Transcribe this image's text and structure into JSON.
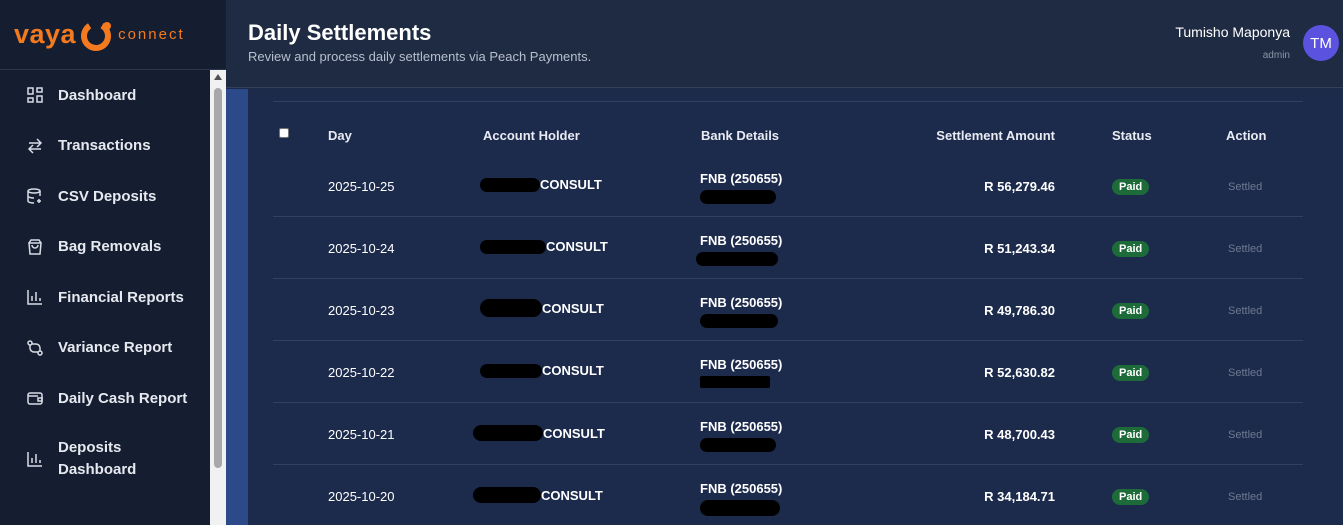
{
  "brand": {
    "word": "vaya",
    "suffix": "connect",
    "color": "#f47a20"
  },
  "sidebar": {
    "items": [
      {
        "label": "Dashboard",
        "icon": "dashboard-grid-icon"
      },
      {
        "label": "Transactions",
        "icon": "arrows-swap-icon"
      },
      {
        "label": "CSV Deposits",
        "icon": "database-icon"
      },
      {
        "label": "Bag Removals",
        "icon": "shopping-bag-icon"
      },
      {
        "label": "Financial Reports",
        "icon": "bar-chart-icon"
      },
      {
        "label": "Variance Report",
        "icon": "git-compare-icon"
      },
      {
        "label": "Daily Cash Report",
        "icon": "wallet-icon"
      },
      {
        "label": "Deposits Dashboard",
        "icon": "bar-chart-icon"
      }
    ]
  },
  "header": {
    "title": "Daily Settlements",
    "subtitle": "Review and process daily settlements via Peach Payments.",
    "user_name": "Tumisho Maponya",
    "user_role": "admin",
    "avatar_initials": "TM"
  },
  "table": {
    "columns": {
      "day": "Day",
      "holder": "Account Holder",
      "bank": "Bank Details",
      "amount": "Settlement Amount",
      "status": "Status",
      "action": "Action"
    },
    "rows": [
      {
        "day": "2025-10-25",
        "holder": "CONSULT",
        "bank": "FNB (250655)",
        "amount": "R 56,279.46",
        "status": "Paid",
        "action": "Settled"
      },
      {
        "day": "2025-10-24",
        "holder": "CONSULT",
        "bank": "FNB (250655)",
        "amount": "R 51,243.34",
        "status": "Paid",
        "action": "Settled"
      },
      {
        "day": "2025-10-23",
        "holder": "CONSULT",
        "bank": "FNB (250655)",
        "amount": "R 49,786.30",
        "status": "Paid",
        "action": "Settled"
      },
      {
        "day": "2025-10-22",
        "holder": "CONSULT",
        "bank": "FNB (250655)",
        "amount": "R 52,630.82",
        "status": "Paid",
        "action": "Settled"
      },
      {
        "day": "2025-10-21",
        "holder": "CONSULT",
        "bank": "FNB (250655)",
        "amount": "R 48,700.43",
        "status": "Paid",
        "action": "Settled"
      },
      {
        "day": "2025-10-20",
        "holder": "CONSULT",
        "bank": "FNB (250655)",
        "amount": "R 34,184.71",
        "status": "Paid",
        "action": "Settled"
      }
    ]
  },
  "colors": {
    "sidebar_bg": "#151e30",
    "header_bg": "#1f2b42",
    "card_bg": "#1c2a4c",
    "paid_badge": "#1e6b3a",
    "avatar": "#5b52e0"
  }
}
